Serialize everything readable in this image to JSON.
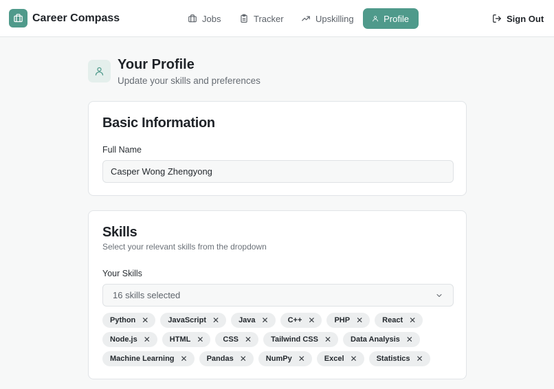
{
  "app": {
    "name": "Career Compass"
  },
  "nav": {
    "items": [
      {
        "label": "Jobs",
        "icon": "briefcase-icon"
      },
      {
        "label": "Tracker",
        "icon": "clipboard-icon"
      },
      {
        "label": "Upskilling",
        "icon": "trending-up-icon"
      },
      {
        "label": "Profile",
        "icon": "user-icon",
        "active": true
      }
    ],
    "sign_out": "Sign Out"
  },
  "header": {
    "title": "Your Profile",
    "subtitle": "Update your skills and preferences"
  },
  "basic_info": {
    "title": "Basic Information",
    "full_name_label": "Full Name",
    "full_name_value": "Casper Wong Zhengyong"
  },
  "skills": {
    "title": "Skills",
    "description": "Select your relevant skills from the dropdown",
    "your_skills_label": "Your Skills",
    "select_value": "16 skills selected",
    "selected": [
      "Python",
      "JavaScript",
      "Java",
      "C++",
      "PHP",
      "React",
      "Node.js",
      "HTML",
      "CSS",
      "Tailwind CSS",
      "Data Analysis",
      "Machine Learning",
      "Pandas",
      "NumPy",
      "Excel",
      "Statistics"
    ]
  },
  "colors": {
    "accent": "#4f9a8b",
    "accent_light": "#e4efec",
    "chip_bg": "#eceeef",
    "page_bg": "#f7f8f8"
  }
}
